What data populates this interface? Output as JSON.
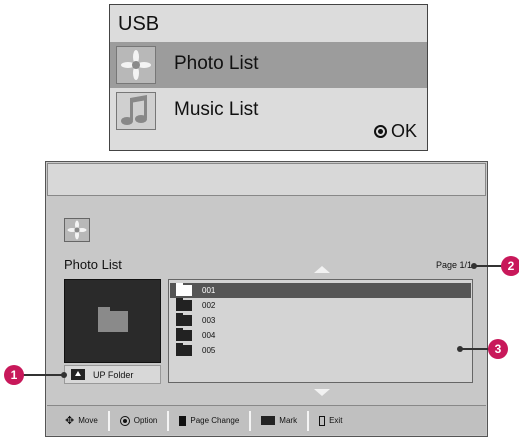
{
  "usb_menu": {
    "title": "USB",
    "items": [
      {
        "label": "Photo List",
        "icon": "photo-thumbnail-icon"
      },
      {
        "label": "Music List",
        "icon": "music-note-icon"
      }
    ],
    "ok_label": "OK"
  },
  "panel": {
    "title": "Photo List",
    "page": "Page 1/1",
    "up_folder": "UP Folder",
    "files": [
      "001",
      "002",
      "003",
      "004",
      "005"
    ],
    "bottom_bar": {
      "move": "Move",
      "option": "Option",
      "page_change": "Page Change",
      "mark": "Mark",
      "exit": "Exit"
    }
  },
  "callouts": [
    "1",
    "2",
    "3"
  ],
  "colors": {
    "callout": "#c8185a",
    "selected_row": "#555555",
    "selected_menu": "#9c9c9c"
  }
}
